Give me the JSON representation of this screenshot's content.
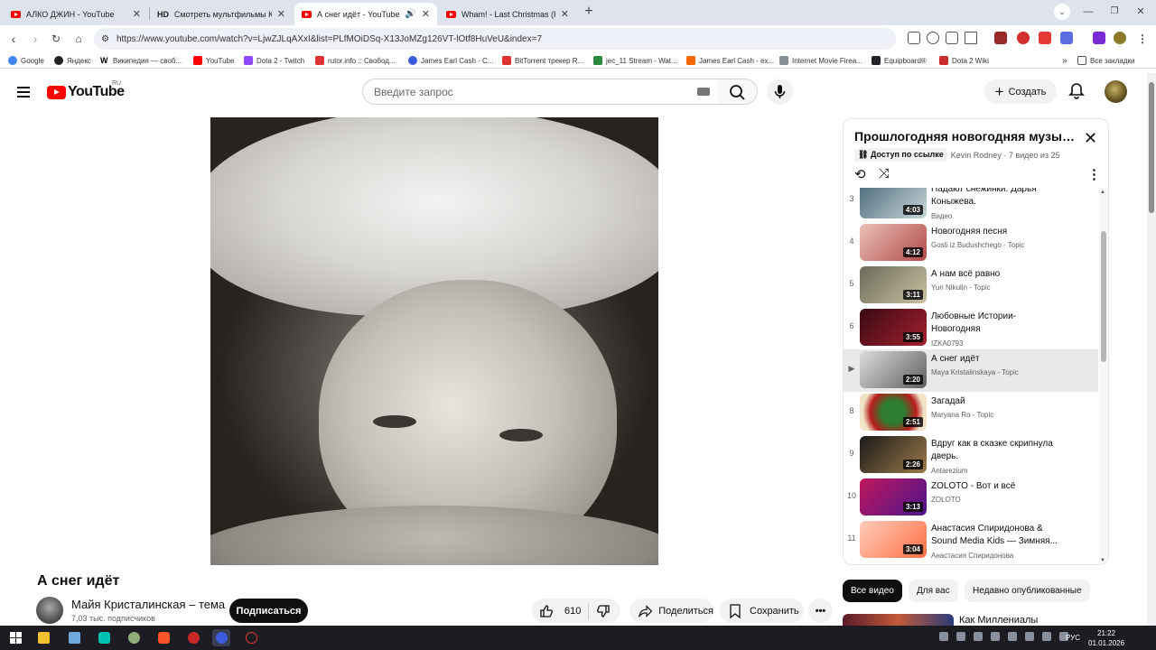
{
  "browser": {
    "tabs": [
      {
        "title": "АЛКО ДЖИН - YouTube",
        "icon": "youtube-icon",
        "active": false
      },
      {
        "title": "Смотреть мультфильмы Клаус о",
        "icon": "hd-icon",
        "active": false
      },
      {
        "title": "А снег идёт - YouTube",
        "icon": "youtube-icon",
        "active": true,
        "audio": true
      },
      {
        "title": "Wham! - Last Christmas (ROCK",
        "icon": "youtube-icon",
        "active": false
      }
    ],
    "hd_badge": "HD",
    "url": "https://www.youtube.com/watch?v=LjwZJLqAXxI&list=PLfMOiDSq-X13JoMZg126VT-lOtf8HuVeU&index=7",
    "bookmarks": [
      {
        "label": "Google",
        "color": "#4285f4"
      },
      {
        "label": "Яндекс",
        "color": "#222222"
      },
      {
        "label": "Википедия — своб...",
        "color": "#555555"
      },
      {
        "label": "YouTube",
        "color": "#ff0000"
      },
      {
        "label": "Dota 2 - Twitch",
        "color": "#9146ff"
      },
      {
        "label": "rutor.info :: Свобод...",
        "color": "#d33"
      },
      {
        "label": "James Earl Cash - C...",
        "color": "#3b5bdb"
      },
      {
        "label": "BitTorrent трекер R...",
        "color": "#e03131"
      },
      {
        "label": "jec_11 Stream - Wat...",
        "color": "#2b8a3e"
      },
      {
        "label": "James Earl Cash - ex...",
        "color": "#f76707"
      },
      {
        "label": "Internet Movie Firea...",
        "color": "#868e96"
      },
      {
        "label": "Equipboard®",
        "color": "#212529"
      },
      {
        "label": "Dota 2 Wiki",
        "color": "#c92a2a"
      }
    ],
    "all_bookmarks": "Все закладки"
  },
  "youtube": {
    "logo_text": "YouTube",
    "country": "RU",
    "search_placeholder": "Введите запрос",
    "create_label": "Создать",
    "accent": "#ff0000"
  },
  "video": {
    "title": "А снег идёт",
    "channel": "Майя Кристалинская – тема",
    "subscribers": "7,03 тыс. подписчиков",
    "subscribe_label": "Подписаться",
    "likes": "610",
    "share_label": "Поделиться",
    "save_label": "Сохранить"
  },
  "playlist": {
    "title": "Прошлогодняя новогодняя музыка...",
    "access": "Доступ по ссылке",
    "owner": "Kevin Rodney",
    "count": "7 видео из 25",
    "items": [
      {
        "index": "3",
        "title": "Падают снежинки. Дарья Коныжева.",
        "channel": "Видео",
        "duration": "4:03",
        "selected": false,
        "thumb": "linear-gradient(135deg,#4a6a7a,#c9d6d8)"
      },
      {
        "index": "4",
        "title": "Новогодняя песня",
        "channel": "Gosti iz Budushchego - Topic",
        "duration": "4:12",
        "selected": false,
        "thumb": "linear-gradient(135deg,#e9c0b6,#b24a4a)"
      },
      {
        "index": "5",
        "title": "А нам всё равно",
        "channel": "Yuri Nikulin - Topic",
        "duration": "3:11",
        "selected": false,
        "thumb": "linear-gradient(135deg,#6b6b5a,#c9c0a0)"
      },
      {
        "index": "6",
        "title": "Любовные Истории- Новогодняя",
        "channel": "IZKA0793",
        "duration": "3:55",
        "selected": false,
        "thumb": "linear-gradient(135deg,#3a0a14,#a3212f)"
      },
      {
        "index": "",
        "title": "А снег идёт",
        "channel": "Maya Kristalinskaya - Topic",
        "duration": "2:20",
        "selected": true,
        "thumb": "linear-gradient(135deg,#dcdcdc,#5f5f5f)"
      },
      {
        "index": "8",
        "title": "Загадай",
        "channel": "Maryana Ro - Topic",
        "duration": "2:51",
        "selected": false,
        "thumb": "radial-gradient(circle,#2e7d32 30%,#b71c1c 60%,#f1e3c6 80%)"
      },
      {
        "index": "9",
        "title": "Вдруг как в сказке скрипнула дверь.",
        "channel": "Antarezium",
        "duration": "2:26",
        "selected": false,
        "thumb": "linear-gradient(135deg,#1a1a1a,#9c7a4a)"
      },
      {
        "index": "10",
        "title": "ZOLOTO - Вот и всё",
        "channel": "ZOLOTO",
        "duration": "3:13",
        "selected": false,
        "thumb": "linear-gradient(135deg,#c2185b,#4a148c)"
      },
      {
        "index": "11",
        "title": "Анастасия Спиридонова & Sound Media Kids — Зимняя...",
        "channel": "Анастасия Спиридонова",
        "duration": "3:04",
        "selected": false,
        "thumb": "linear-gradient(135deg,#ffccbc,#ff7043)"
      }
    ]
  },
  "chips": [
    "Все видео",
    "Для вас",
    "Недавно опубликованные"
  ],
  "recommendation": {
    "title": "Как Миллениалы"
  },
  "taskbar": {
    "lang": "РУС",
    "time": "21:22",
    "date": "01.01.2026"
  }
}
